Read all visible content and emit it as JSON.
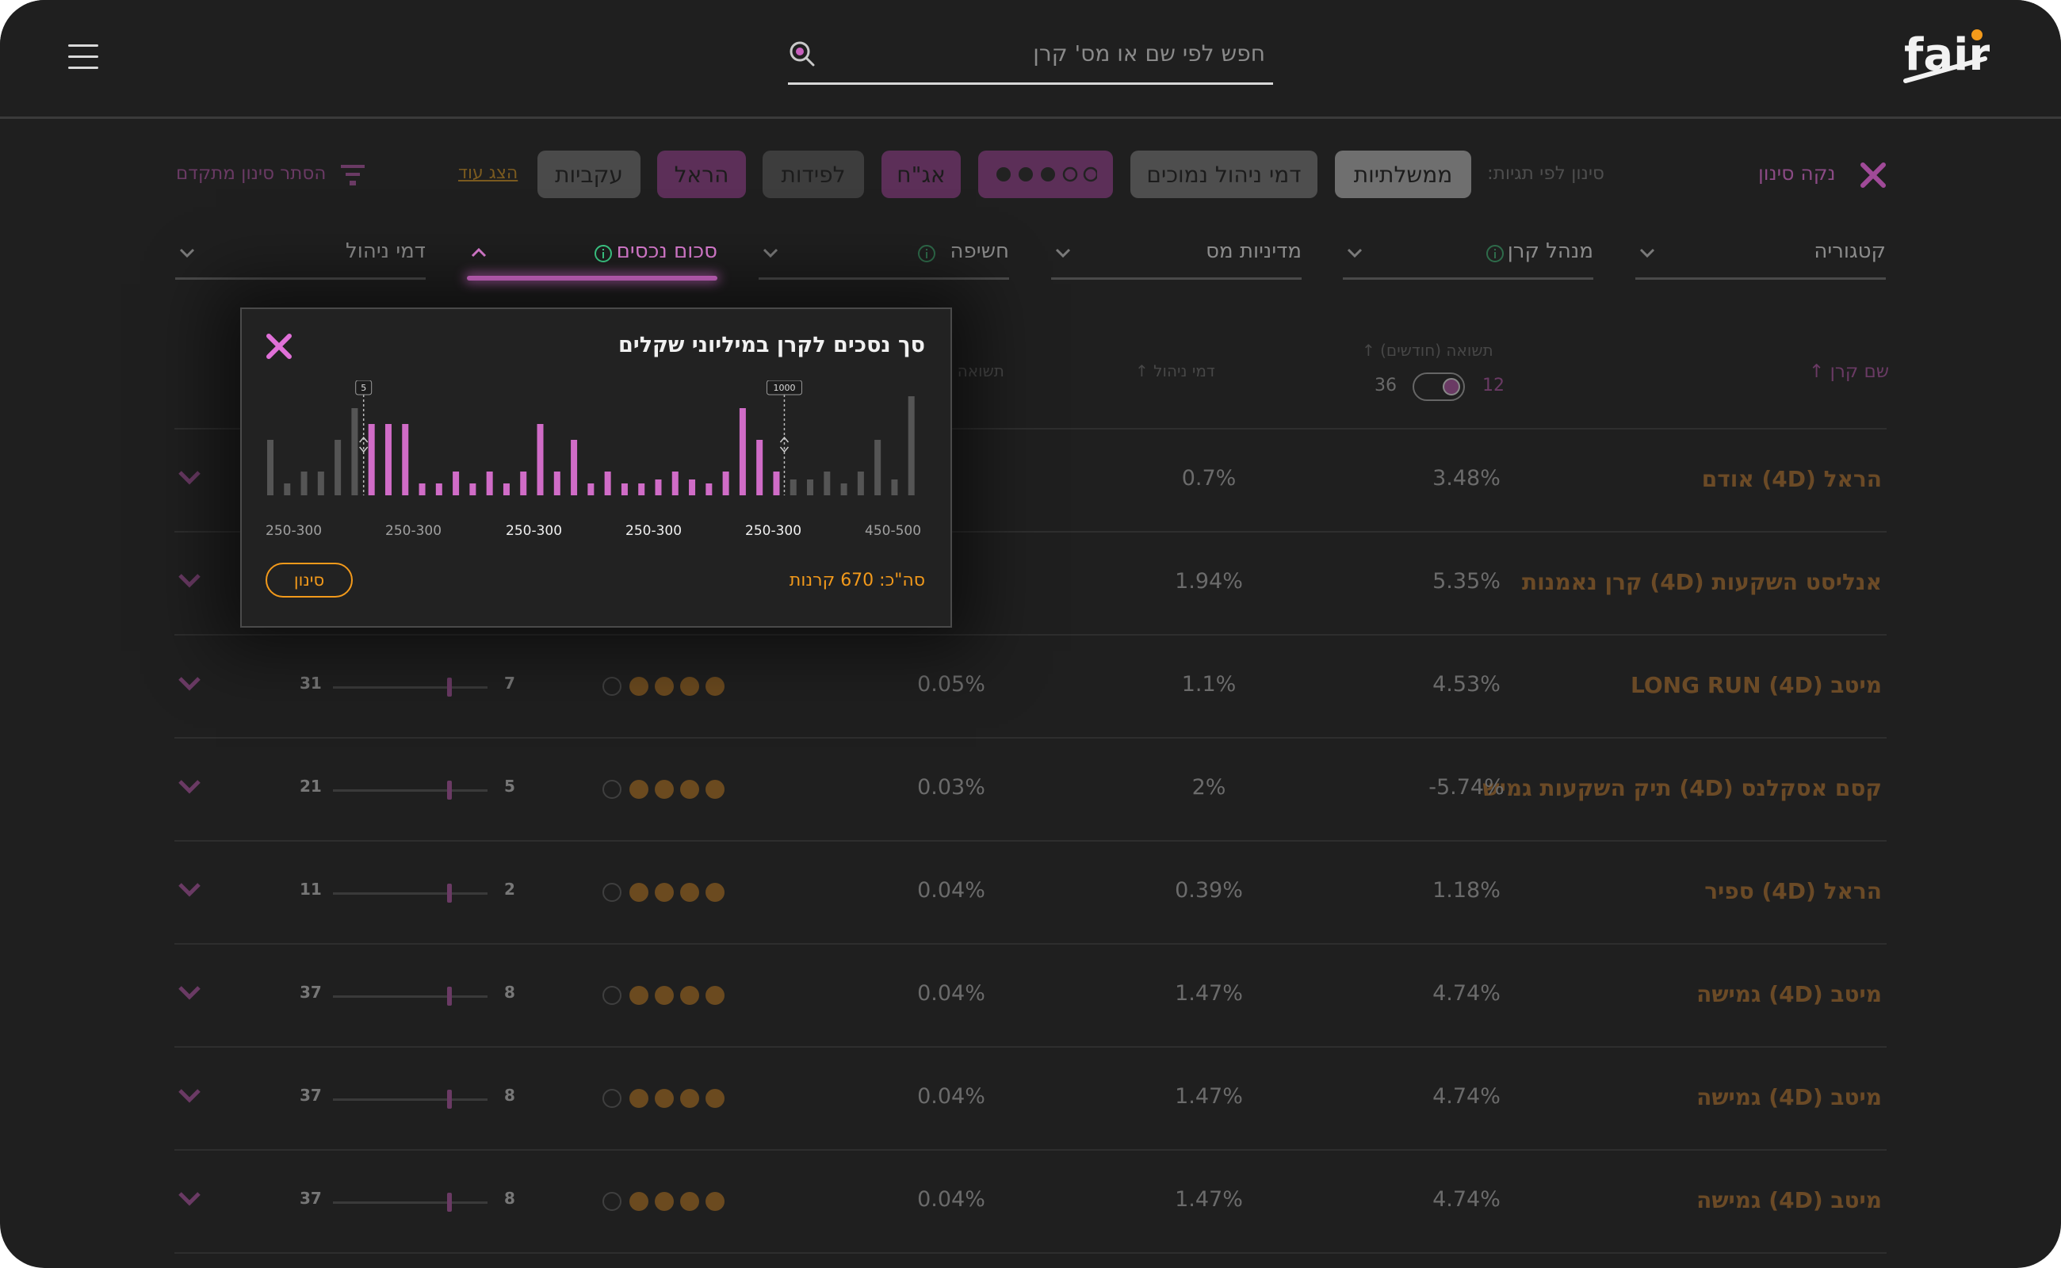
{
  "header": {
    "search_placeholder": "חפש לפי שם או מס' קרן",
    "logo_text": "fair"
  },
  "filters": {
    "clear_label": "נקה סינון",
    "by_tags_label": "סינון לפי תגיות:",
    "tags": [
      "ממשלתיות",
      "דמי ניהול נמוכים",
      "אג\"ח",
      "לפידות",
      "הראל",
      "עקביות"
    ],
    "show_more": "הצג עוד",
    "hide_advanced": "הסתר סינון מתקדם"
  },
  "dropdowns": [
    "קטגוריה",
    "מנהל קרן",
    "מדיניות מס",
    "חשיפה",
    "סכום נכסים",
    "דמי ניהול"
  ],
  "table": {
    "col_fund_name": "שם קרן",
    "col_return": "תשואה (חודשים)",
    "toggle_left": "36",
    "toggle_right": "12",
    "col_fee": "דמי ניהול",
    "col_return2": "תשואה ל",
    "rows": [
      {
        "name": "הראל (4D) אודם",
        "ret": "3.48%",
        "fee": "0.7%",
        "r2": "",
        "min": "",
        "max": "",
        "dots": 0
      },
      {
        "name": "אנליסט השקעות (4D) קרן נאמנות",
        "ret": "5.35%",
        "fee": "1.94%",
        "r2": "",
        "min": "",
        "max": "",
        "dots": 0
      },
      {
        "name": "מיטב LONG RUN (4D)",
        "ret": "4.53%",
        "fee": "1.1%",
        "r2": "0.05%",
        "min": "7",
        "max": "31",
        "dots": 4
      },
      {
        "name": "קסם אסקלנס (4D) תיק השקעות גמיש",
        "ret": "-5.74%",
        "fee": "2%",
        "r2": "0.03%",
        "min": "5",
        "max": "21",
        "dots": 4
      },
      {
        "name": "הראל (4D) ספיר",
        "ret": "1.18%",
        "fee": "0.39%",
        "r2": "0.04%",
        "min": "2",
        "max": "11",
        "dots": 4
      },
      {
        "name": "מיטב (4D) גמישה",
        "ret": "4.74%",
        "fee": "1.47%",
        "r2": "0.04%",
        "min": "8",
        "max": "37",
        "dots": 4
      },
      {
        "name": "מיטב (4D) גמישה",
        "ret": "4.74%",
        "fee": "1.47%",
        "r2": "0.04%",
        "min": "8",
        "max": "37",
        "dots": 4
      },
      {
        "name": "מיטב (4D) גמישה",
        "ret": "4.74%",
        "fee": "1.47%",
        "r2": "0.04%",
        "min": "8",
        "max": "37",
        "dots": 4
      }
    ]
  },
  "popup": {
    "title": "סך נסכים לקרן במיליוני שקלים",
    "total": "סה\"כ: 670 קרנות",
    "button": "סינון",
    "handle_min": "5",
    "handle_max": "1000",
    "x_labels": [
      "250-300",
      "250-300",
      "250-300",
      "250-300",
      "250-300",
      "450-500"
    ]
  },
  "chart_data": {
    "type": "bar",
    "values": [
      7,
      1.5,
      3,
      3,
      7,
      11,
      9,
      9,
      9,
      1.5,
      1.5,
      3,
      1.5,
      3,
      1.5,
      3,
      9,
      3,
      7,
      1.5,
      3,
      1.5,
      1.5,
      2,
      3,
      2,
      1.5,
      3,
      11,
      7,
      3,
      2,
      2,
      3,
      1.5,
      3,
      7,
      2,
      12.5
    ],
    "selected_range": [
      6,
      30
    ],
    "colors": {
      "selected": "#d06cc7",
      "unselected": "#555555"
    }
  }
}
